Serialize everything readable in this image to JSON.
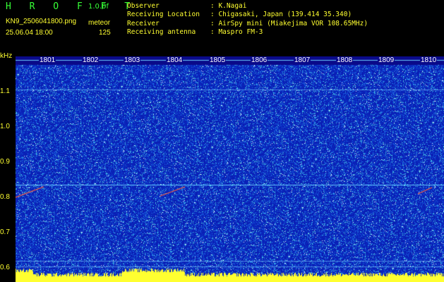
{
  "header": {
    "app_title": "H R O F F T",
    "version": "1.0.0f",
    "filename": "KN9_2506041800.png",
    "mode": "meteor",
    "datetime": "25.06.04  18:00",
    "count": "125",
    "info": [
      {
        "key": "Observer",
        "value": ": K.Nagai"
      },
      {
        "key": "Receiving Location",
        "value": ": Chigasaki, Japan (139.414 35.340)"
      },
      {
        "key": "Receiver",
        "value": ": AirSpy mini (Miakejima VOR 108.65MHz)"
      },
      {
        "key": "Receiving antenna",
        "value": ": Maspro FM-3"
      }
    ]
  },
  "axis": {
    "unit": "kHz",
    "ticks": [
      "1.1",
      "1.0",
      "0.9",
      "0.8",
      "0.7",
      "0.6"
    ]
  },
  "time_labels": [
    "1801",
    "1802",
    "1803",
    "1804",
    "1805",
    "1806",
    "1807",
    "1808",
    "1809",
    "1810"
  ],
  "colors": {
    "background": "#0a1eb4",
    "header_text": "#ffff30",
    "logo_text": "#36ff36",
    "carrier_line": "#66ccff"
  }
}
